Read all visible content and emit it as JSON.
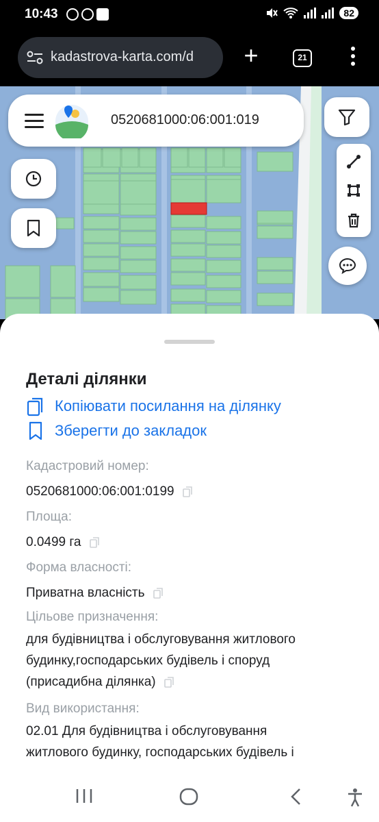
{
  "status_bar": {
    "time": "10:43",
    "battery": "82"
  },
  "browser": {
    "url": "kadastrova-karta.com/d",
    "tab_count": "21",
    "new_tab_label": "+"
  },
  "map": {
    "parcel_id_header": "0520681000:06:001:019",
    "colors": {
      "water": "#8eb0d9",
      "parcel": "#9ad6a9",
      "selected_parcel": "#e53935",
      "road": "#ffffff"
    }
  },
  "sheet": {
    "title": "Деталі ділянки",
    "actions": [
      {
        "label": "Копіювати посилання на ділянку",
        "icon": "copy-link-icon"
      },
      {
        "label": "Зберегти до закладок",
        "icon": "bookmark-icon"
      }
    ],
    "fields": [
      {
        "label": "Кадастровий номер:",
        "lines": [
          "0520681000:06:001:0199"
        ]
      },
      {
        "label": "Площа:",
        "lines": [
          "0.0499 га"
        ]
      },
      {
        "label": "Форма власності:",
        "lines": [
          "Приватна власність"
        ]
      },
      {
        "label": "Цільове призначення:",
        "lines": [
          "для будівництва і обслуговування житлового",
          "будинку,господарських будівель і споруд",
          "(присадибна ділянка)"
        ]
      },
      {
        "label": "Вид використання:",
        "lines": [
          "02.01 Для будівництва і обслуговування",
          "житлового будинку, господарських будівель і"
        ]
      }
    ]
  },
  "accent_color": "#1a73e8"
}
